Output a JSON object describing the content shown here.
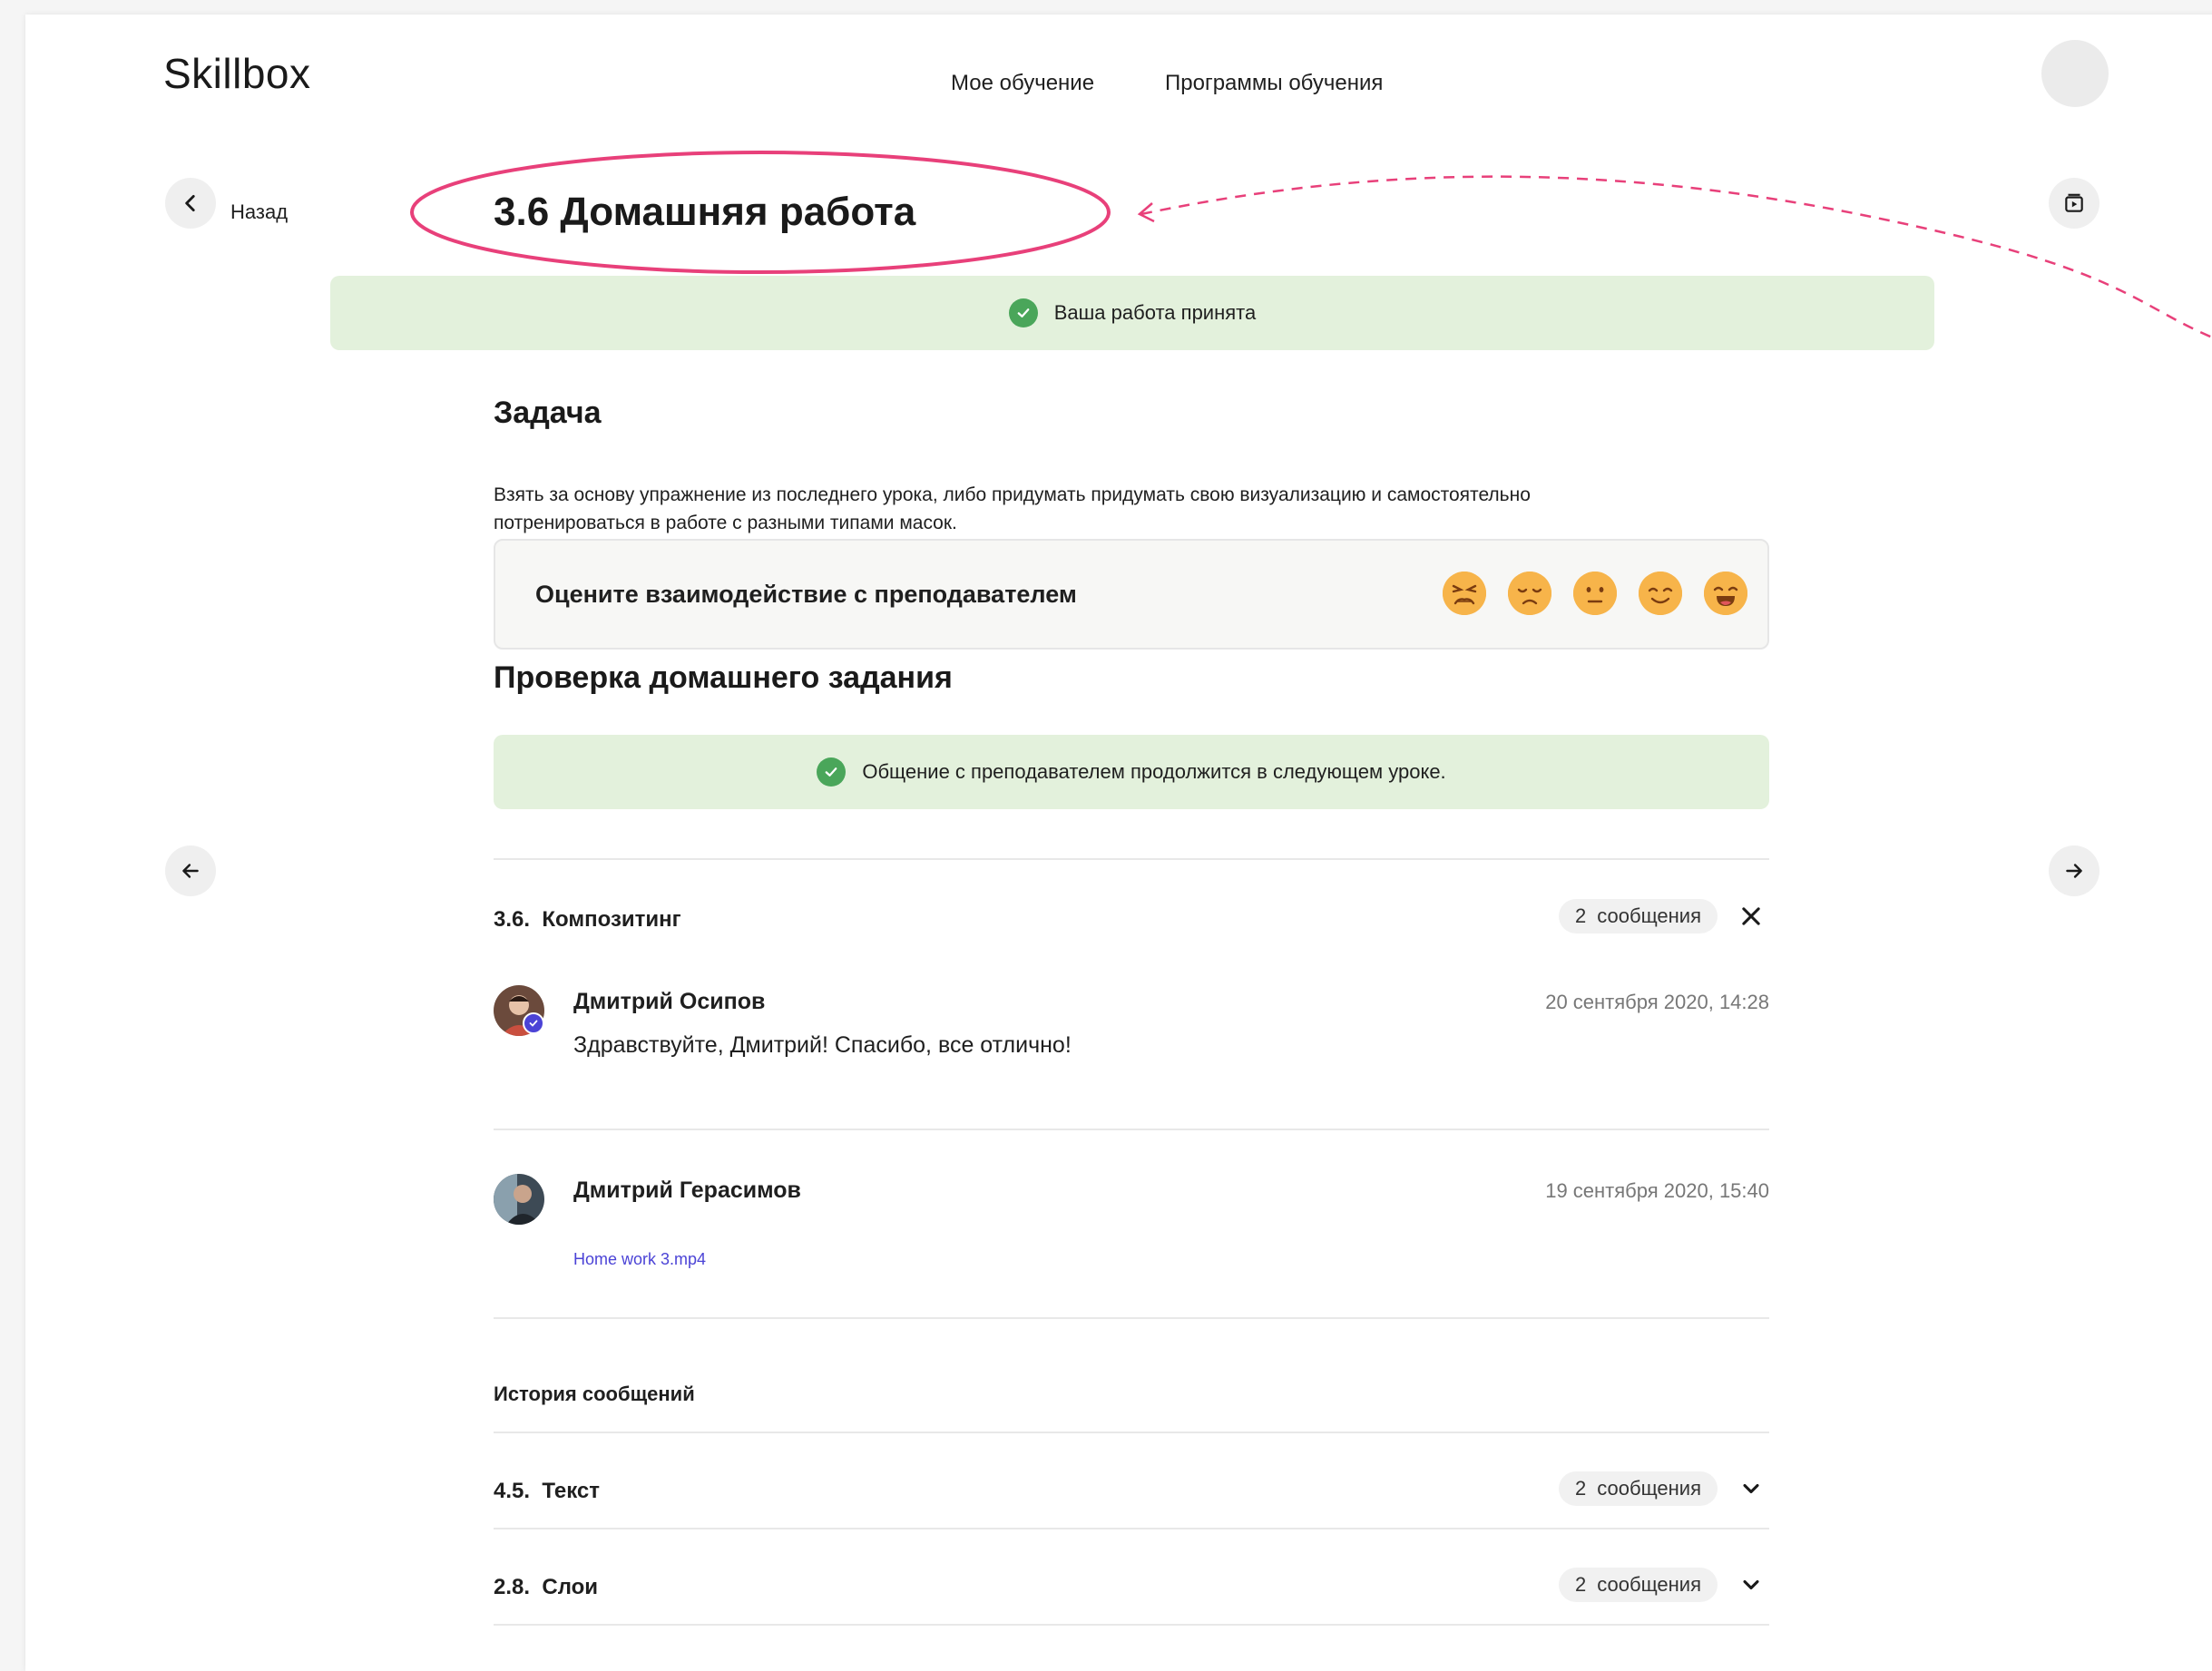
{
  "header": {
    "logo": "Skillbox",
    "nav": [
      "Мое обучение",
      "Программы обучения"
    ]
  },
  "toolbar": {
    "back_label": "Назад"
  },
  "page_title": "3.6 Домашняя работа",
  "status_banner": "Ваша работа принята",
  "task": {
    "heading": "Задача",
    "text_line1": "Взять за основу упражнение из последнего урока, либо придумать придумать свою визуализацию и самостоятельно",
    "text_line2": "потренироваться в работе с разными типами масок."
  },
  "rating": {
    "label": "Оцените взаимодействие с преподавателем",
    "options": [
      "angry-face-icon",
      "sad-face-icon",
      "neutral-face-icon",
      "smiling-face-icon",
      "happy-face-icon"
    ]
  },
  "review": {
    "heading": "Проверка домашнего задания",
    "banner": "Общение с преподавателем продолжится в следующем уроке."
  },
  "thread": {
    "number": "3.6.",
    "title": "Композитинг",
    "count": "2",
    "count_label": "сообщения",
    "messages": [
      {
        "author": "Дмитрий Осипов",
        "date": "20 сентября 2020, 14:28",
        "text": "Здравствуйте, Дмитрий! Спасибо, все отлично!"
      },
      {
        "author": "Дмитрий Герасимов",
        "date": "19 сентября 2020, 15:40",
        "attachment": "Home work 3.mp4"
      }
    ]
  },
  "history": {
    "heading": "История сообщений",
    "items": [
      {
        "number": "4.5.",
        "title": "Текст",
        "count": "2",
        "count_label": "сообщения"
      },
      {
        "number": "2.8.",
        "title": "Слои",
        "count": "2",
        "count_label": "сообщения"
      }
    ]
  },
  "colors": {
    "accent_annotation": "#e8407a",
    "success": "#4aa65a",
    "success_bg": "#e3f1dc",
    "link": "#4b43d6"
  }
}
